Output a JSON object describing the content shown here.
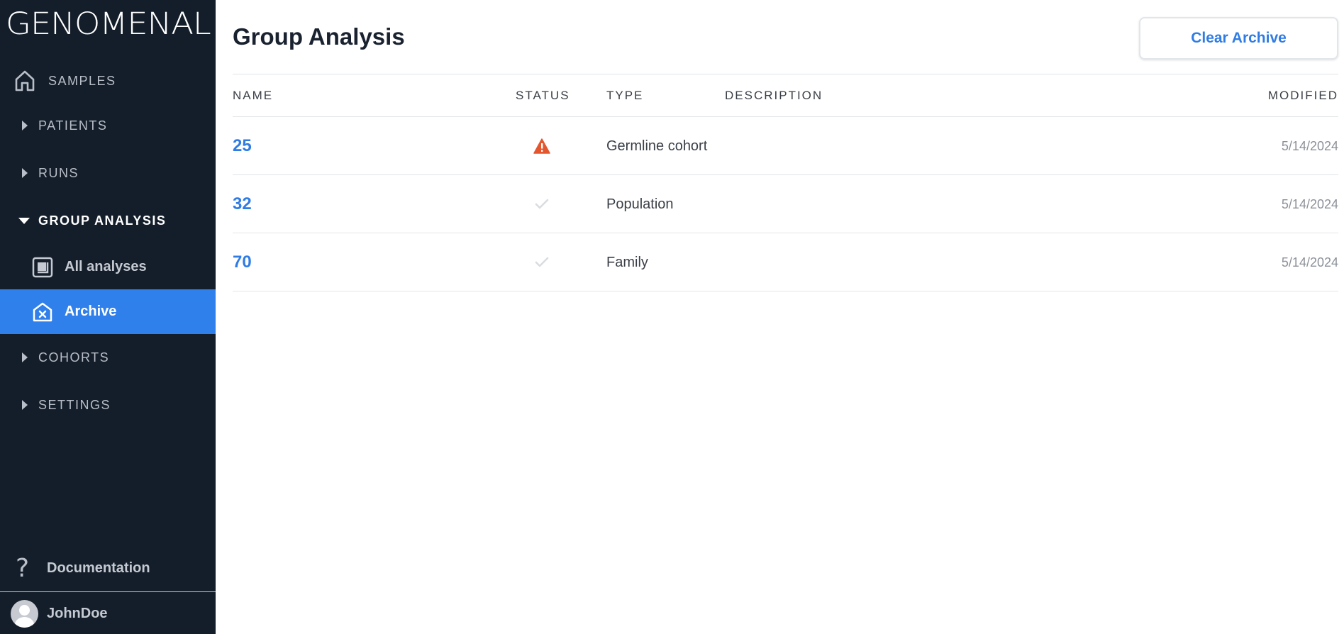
{
  "app": {
    "logo_text": "GENOMENAL"
  },
  "sidebar": {
    "samples": {
      "label": "SAMPLES",
      "icon": "home-icon"
    },
    "patients": {
      "label": "PATIENTS"
    },
    "runs": {
      "label": "RUNS"
    },
    "group_analysis": {
      "label": "GROUP ANALYSIS",
      "expanded": true,
      "items": [
        {
          "label": "All analyses",
          "icon": "layers-icon",
          "active": false
        },
        {
          "label": "Archive",
          "icon": "archive-x-icon",
          "active": true
        }
      ]
    },
    "cohorts": {
      "label": "COHORTS"
    },
    "settings": {
      "label": "SETTINGS"
    },
    "documentation": {
      "label": "Documentation",
      "icon": "question-icon"
    },
    "user": {
      "name": "JohnDoe"
    }
  },
  "main": {
    "title": "Group Analysis",
    "clear_button": "Clear Archive",
    "table": {
      "columns": {
        "name": "NAME",
        "status": "STATUS",
        "type": "TYPE",
        "description": "DESCRIPTION",
        "modified": "MODIFIED"
      },
      "rows": [
        {
          "name": "25",
          "status": "warning",
          "type": "Germline cohort",
          "description": "",
          "modified": "5/14/2024"
        },
        {
          "name": "32",
          "status": "complete",
          "type": "Population",
          "description": "",
          "modified": "5/14/2024"
        },
        {
          "name": "70",
          "status": "complete",
          "type": "Family",
          "description": "",
          "modified": "5/14/2024"
        }
      ]
    }
  },
  "colors": {
    "sidebar_bg": "#141e2a",
    "accent": "#2f80ea",
    "warning": "#e4572e",
    "check": "#d9dce0"
  }
}
